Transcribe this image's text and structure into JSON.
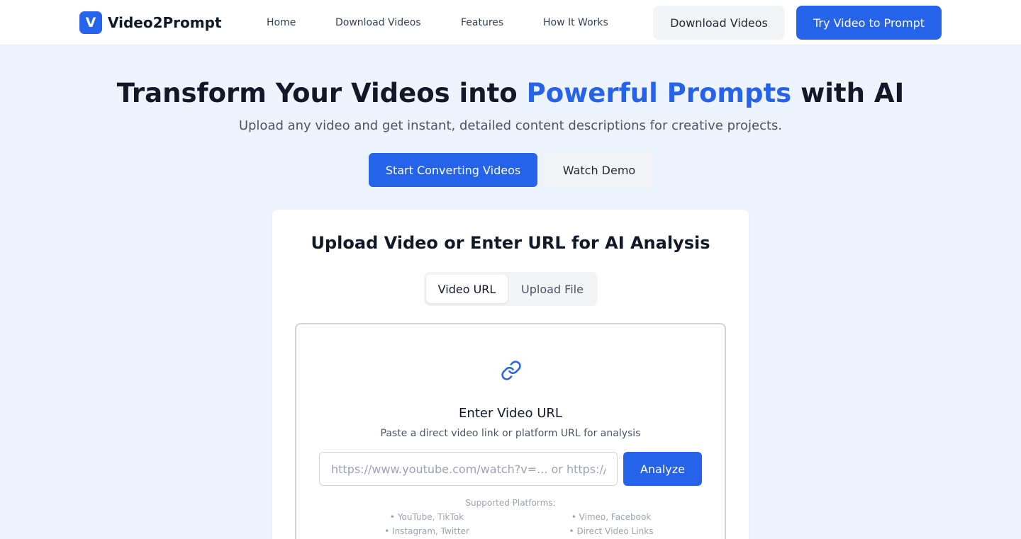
{
  "header": {
    "logo_letter": "V",
    "brand": "Video2Prompt",
    "nav": [
      "Home",
      "Download Videos",
      "Features",
      "How It Works"
    ],
    "download_button": "Download Videos",
    "try_button": "Try Video to Prompt"
  },
  "hero": {
    "title_before": "Transform Your Videos into ",
    "title_accent": "Powerful Prompts",
    "title_after": " with AI",
    "subtitle": "Upload any video and get instant, detailed content descriptions for creative projects.",
    "primary_button": "Start Converting Videos",
    "secondary_button": "Watch Demo"
  },
  "card": {
    "title": "Upload Video or Enter URL for AI Analysis",
    "tabs": [
      {
        "label": "Video URL",
        "active": true
      },
      {
        "label": "Upload File",
        "active": false
      }
    ],
    "url_section": {
      "icon": "link-icon",
      "title": "Enter Video URL",
      "subtitle": "Paste a direct video link or platform URL for analysis",
      "placeholder": "https://www.youtube.com/watch?v=... or https://...",
      "value": "",
      "analyze_button": "Analyze",
      "supported_label": "Supported Platforms:",
      "platforms": [
        "• YouTube, TikTok",
        "• Vimeo, Facebook",
        "• Instagram, Twitter",
        "• Direct Video Links"
      ]
    }
  },
  "colors": {
    "accent": "#2563eb",
    "page_background": "#eef4fe",
    "card_background": "#ffffff"
  }
}
